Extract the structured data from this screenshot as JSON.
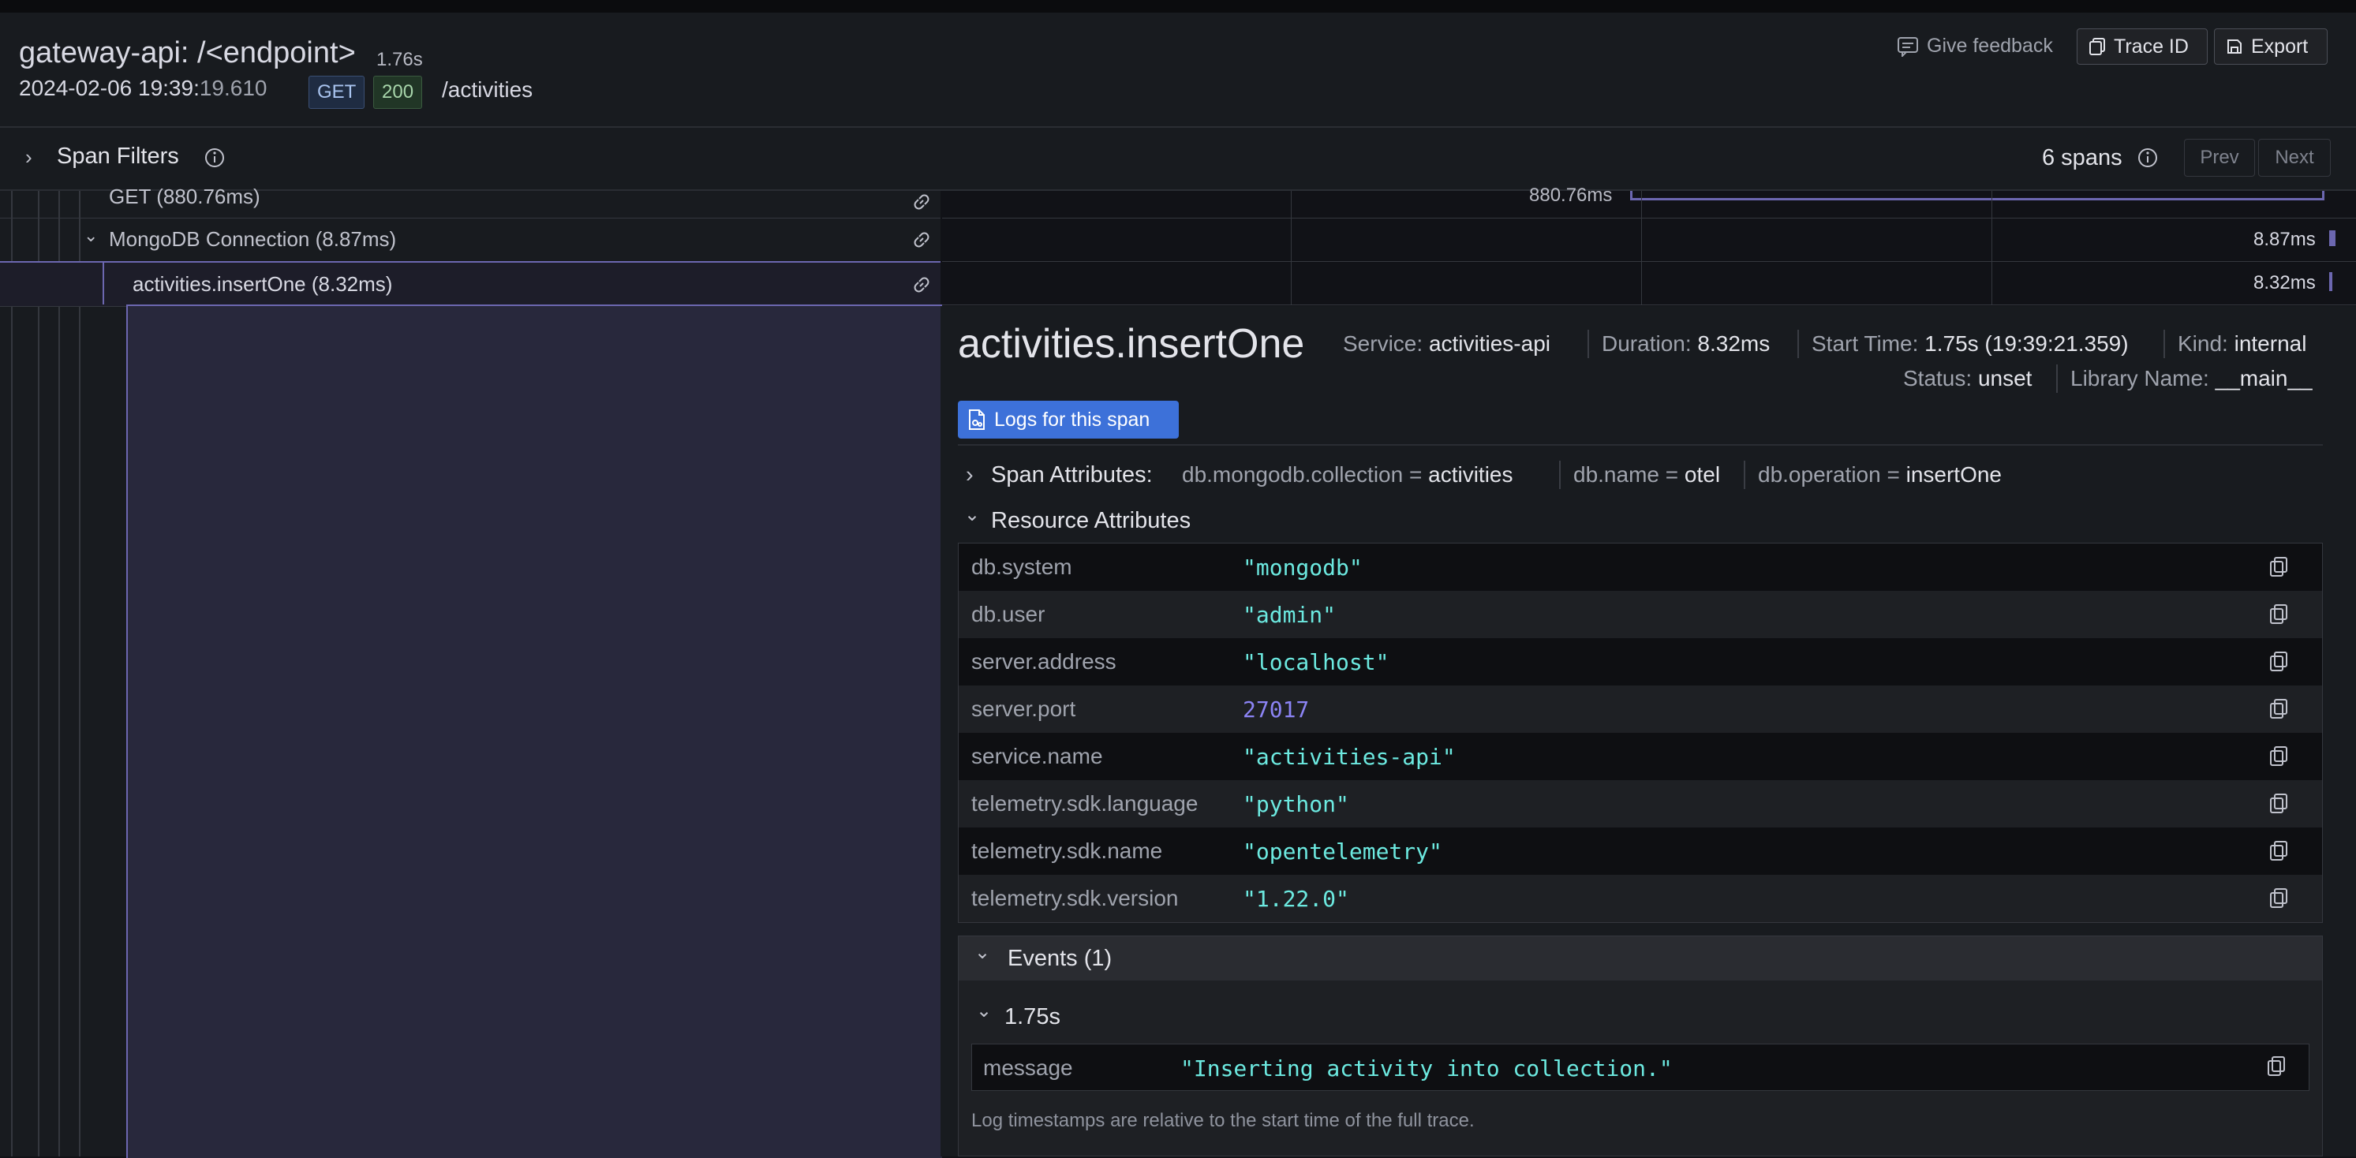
{
  "header": {
    "title": "gateway-api: /<endpoint>",
    "duration": "1.76s",
    "timestamp_main": "2024-02-06 19:39:",
    "timestamp_ms": "19.610",
    "method": "GET",
    "status_code": "200",
    "path": "/activities",
    "give_feedback": "Give feedback",
    "trace_id_button": "Trace ID",
    "export_button": "Export"
  },
  "filters": {
    "label": "Span Filters",
    "span_count": "6 spans",
    "prev": "Prev",
    "next": "Next"
  },
  "tree": {
    "rows": [
      {
        "label": "GET (880.76ms)",
        "bar_label": "880.76ms"
      },
      {
        "label": "MongoDB Connection (8.87ms)",
        "bar_label": "8.87ms"
      },
      {
        "label": "activities.insertOne (8.32ms)",
        "bar_label": "8.32ms"
      }
    ]
  },
  "detail": {
    "span_name": "activities.insertOne",
    "service_label": "Service:",
    "service_value": "activities-api",
    "duration_label": "Duration:",
    "duration_value": "8.32ms",
    "start_label": "Start Time:",
    "start_value": "1.75s (19:39:21.359)",
    "kind_label": "Kind:",
    "kind_value": "internal",
    "status_label": "Status:",
    "status_value": "unset",
    "library_label": "Library Name:",
    "library_value": "__main__",
    "logs_button": "Logs for this span",
    "span_attributes": {
      "label": "Span Attributes:",
      "items": [
        {
          "key": "db.mongodb.collection",
          "eq": "=",
          "value": "activities"
        },
        {
          "key": "db.name",
          "eq": "=",
          "value": "otel"
        },
        {
          "key": "db.operation",
          "eq": "=",
          "value": "insertOne"
        }
      ]
    },
    "resource_attributes": {
      "label": "Resource Attributes",
      "rows": [
        {
          "key": "db.system",
          "value": "\"mongodb\""
        },
        {
          "key": "db.user",
          "value": "\"admin\""
        },
        {
          "key": "server.address",
          "value": "\"localhost\""
        },
        {
          "key": "server.port",
          "value": "27017"
        },
        {
          "key": "service.name",
          "value": "\"activities-api\""
        },
        {
          "key": "telemetry.sdk.language",
          "value": "\"python\""
        },
        {
          "key": "telemetry.sdk.name",
          "value": "\"opentelemetry\""
        },
        {
          "key": "telemetry.sdk.version",
          "value": "\"1.22.0\""
        }
      ]
    },
    "events": {
      "label": "Events (1)",
      "time": "1.75s",
      "key": "message",
      "value": "\"Inserting activity into collection.\"",
      "note": "Log timestamps are relative to the start time of the full trace."
    }
  },
  "colors": {
    "accent_blue": "#3d71d9",
    "span_bar": "#6c67b0",
    "string_value": "#6ce9e0",
    "number_value": "#8c84f5"
  }
}
